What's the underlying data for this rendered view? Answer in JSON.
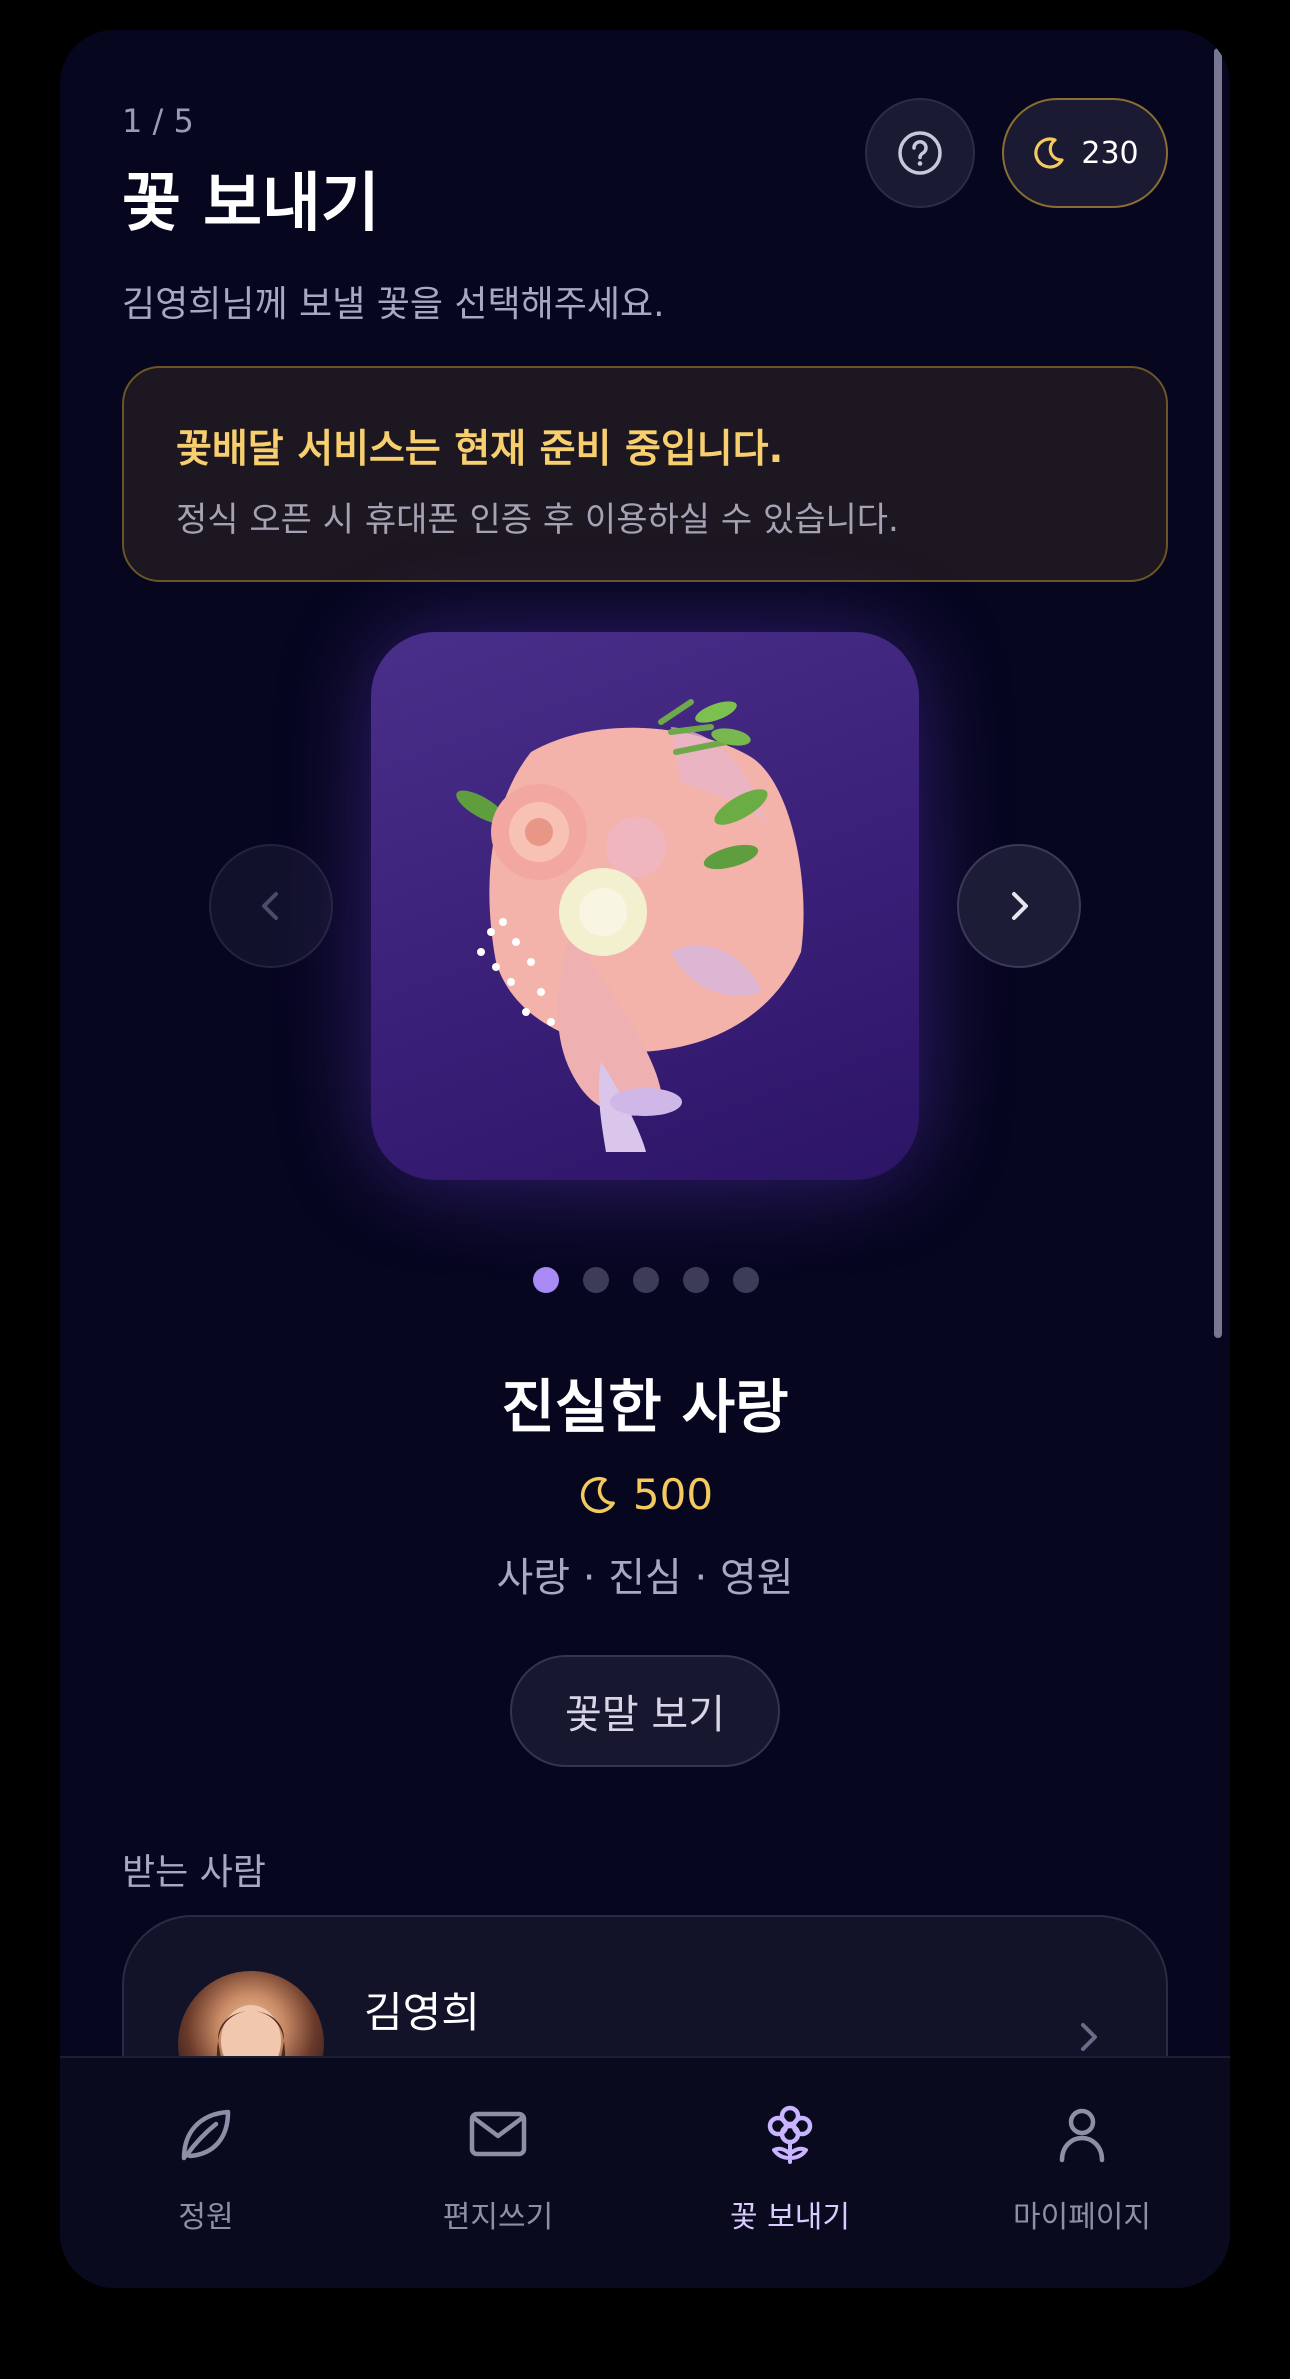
{
  "header": {
    "step": "1 / 5",
    "title": "꽃 보내기",
    "moon_balance": "230",
    "subtitle": "김영희님께 보낼 꽃을 선택해주세요."
  },
  "notice": {
    "title": "꽃배달 서비스는 현재 준비 중입니다.",
    "text": "정식 오픈 시 휴대폰 인증 후 이용하실 수 있습니다."
  },
  "carousel": {
    "current_index": 1,
    "total": 5
  },
  "flower": {
    "name": "진실한 사랑",
    "price": "500",
    "tags": "사랑 · 진심 · 영원",
    "meaning_button": "꽃말 보기"
  },
  "recipient": {
    "label": "받는 사람",
    "name": "김영희"
  },
  "bottom_nav": [
    {
      "label": "정원",
      "icon": "leaf-icon"
    },
    {
      "label": "편지쓰기",
      "icon": "mail-icon"
    },
    {
      "label": "꽃 보내기",
      "icon": "flower-icon",
      "active": true
    },
    {
      "label": "마이페이지",
      "icon": "user-icon"
    }
  ],
  "colors": {
    "background": "#06061f",
    "accent": "#a98af5",
    "gold": "#f4c95d",
    "notice_border": "#6b5526"
  }
}
